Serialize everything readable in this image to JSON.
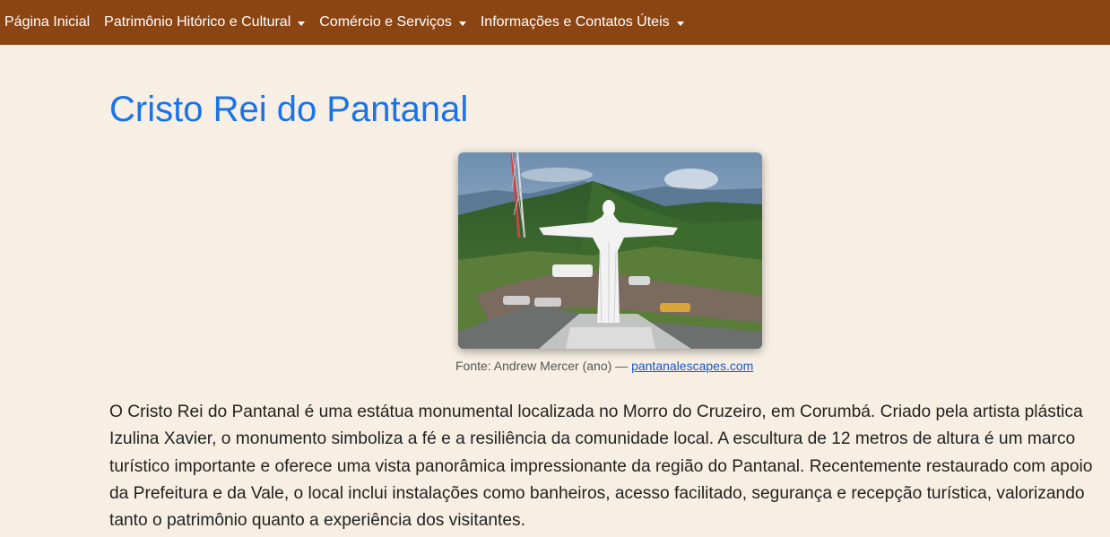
{
  "nav": {
    "items": [
      {
        "label": "Página Inicial",
        "dropdown": false
      },
      {
        "label": "Patrimônio Hitórico e Cultural",
        "dropdown": true
      },
      {
        "label": "Comércio e Serviços",
        "dropdown": true
      },
      {
        "label": "Informações e Contatos Úteis",
        "dropdown": true
      }
    ]
  },
  "main": {
    "title": "Cristo Rei do Pantanal",
    "caption_prefix": "Fonte: Andrew Mercer (ano) —",
    "caption_link": "pantanalescapes.com",
    "paragraph": "O Cristo Rei do Pantanal é uma estátua monumental localizada no Morro do Cruzeiro, em Corumbá. Criado pela artista plástica Izulina Xavier, o monumento simboliza a fé e a resiliência da comunidade local. A escultura de 12 metros de altura é um marco turístico importante e oferece uma vista panorâmica impressionante da região do Pantanal. Recentemente restaurado com apoio da Prefeitura e da Vale, o local inclui instalações como banheiros, acesso facilitado, segurança e recepção turística, valorizando tanto o patrimônio quanto a experiência dos visitantes."
  },
  "colors": {
    "navbar": "#8b4513",
    "background": "#f7efe3",
    "title": "#1a73e8"
  }
}
